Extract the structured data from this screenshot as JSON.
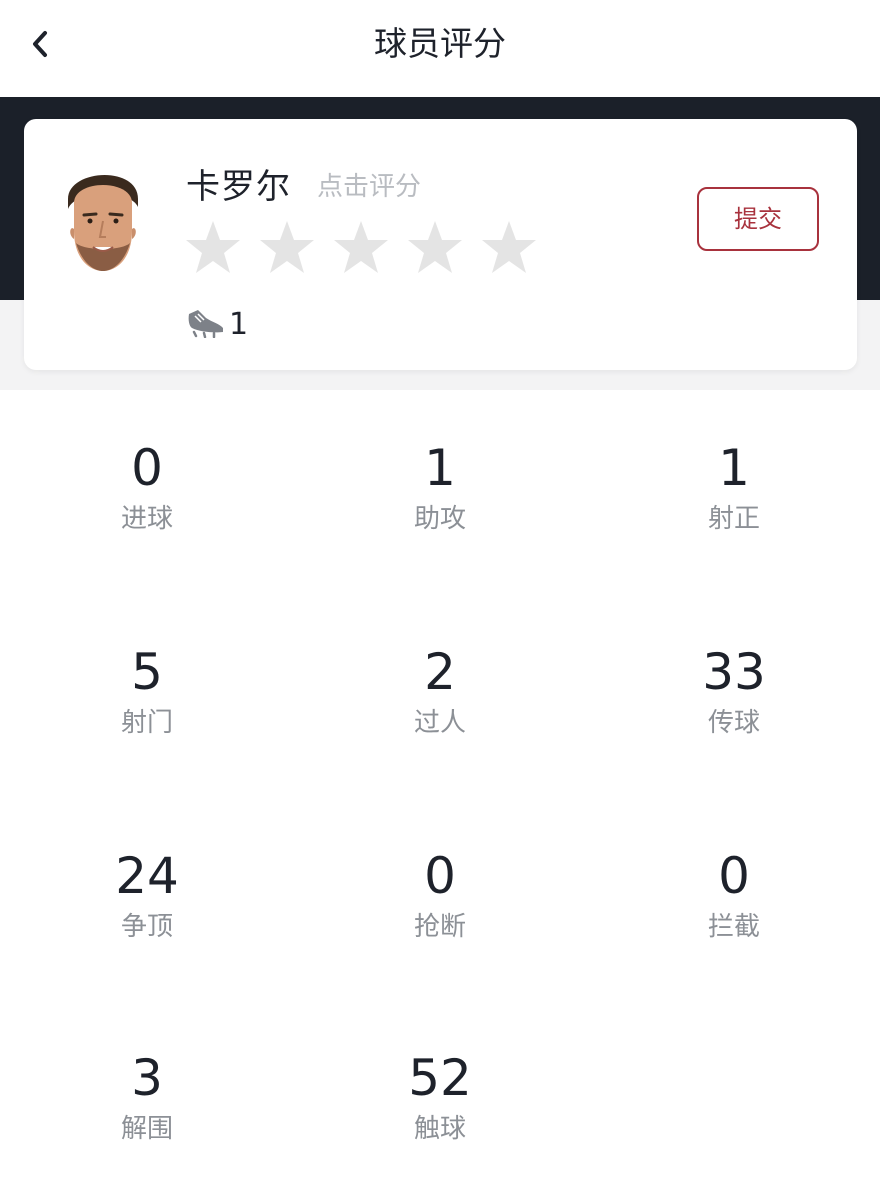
{
  "header": {
    "title": "球员评分",
    "back_icon": "chevron-left-icon"
  },
  "player": {
    "name": "卡罗尔",
    "rate_hint": "点击评分",
    "rating": {
      "value": 0,
      "max": 5
    },
    "boot_icon": "football-boot-icon",
    "boot_count": "1"
  },
  "submit_label": "提交",
  "colors": {
    "dark_band": "#1b2029",
    "accent": "#a8323d",
    "star_empty": "#e4e4e4"
  },
  "stats": [
    {
      "value": "0",
      "label": "进球"
    },
    {
      "value": "1",
      "label": "助攻"
    },
    {
      "value": "1",
      "label": "射正"
    },
    {
      "value": "5",
      "label": "射门"
    },
    {
      "value": "2",
      "label": "过人"
    },
    {
      "value": "33",
      "label": "传球"
    },
    {
      "value": "24",
      "label": "争顶"
    },
    {
      "value": "0",
      "label": "抢断"
    },
    {
      "value": "0",
      "label": "拦截"
    },
    {
      "value": "3",
      "label": "解围"
    },
    {
      "value": "52",
      "label": "触球"
    }
  ]
}
